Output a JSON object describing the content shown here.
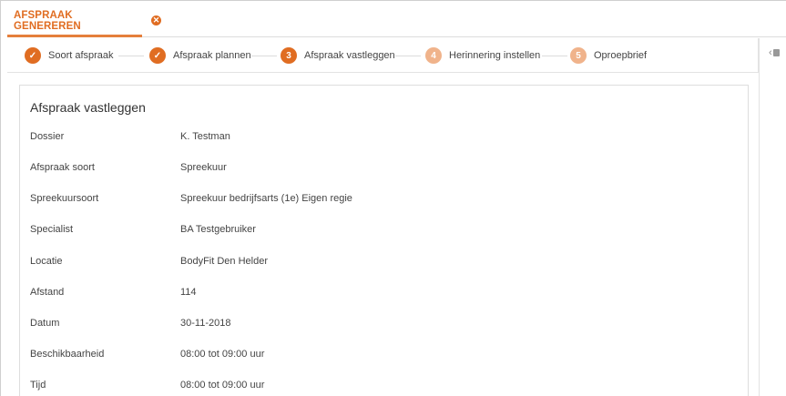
{
  "tab": {
    "label": "AFSPRAAK GENEREREN",
    "close_symbol": "✕"
  },
  "steps": [
    {
      "number": "✓",
      "label": "Soort afspraak",
      "state": "done"
    },
    {
      "number": "✓",
      "label": "Afspraak plannen",
      "state": "done"
    },
    {
      "number": "3",
      "label": "Afspraak vastleggen",
      "state": "active"
    },
    {
      "number": "4",
      "label": "Herinnering instellen",
      "state": "todo"
    },
    {
      "number": "5",
      "label": "Oproepbrief",
      "state": "todo"
    }
  ],
  "card": {
    "title": "Afspraak vastleggen",
    "rows": [
      {
        "label": "Dossier",
        "value": "K. Testman"
      },
      {
        "label": "Afspraak soort",
        "value": "Spreekuur"
      },
      {
        "label": "Spreekuursoort",
        "value": "Spreekuur bedrijfsarts (1e) Eigen regie"
      },
      {
        "label": "Specialist",
        "value": "BA Testgebruiker"
      },
      {
        "label": "Locatie",
        "value": "BodyFit Den Helder"
      },
      {
        "label": "Afstand",
        "value": "114"
      },
      {
        "label": "Datum",
        "value": "30-11-2018"
      },
      {
        "label": "Beschikbaarheid",
        "value": "08:00 tot 09:00 uur"
      },
      {
        "label": "Tijd",
        "value": "08:00 tot 09:00 uur"
      }
    ]
  },
  "side_panel": {
    "collapse_icon": "‹"
  },
  "colors": {
    "accent": "#e06d22",
    "accent_light": "#f0b38b",
    "border": "#dedede"
  }
}
